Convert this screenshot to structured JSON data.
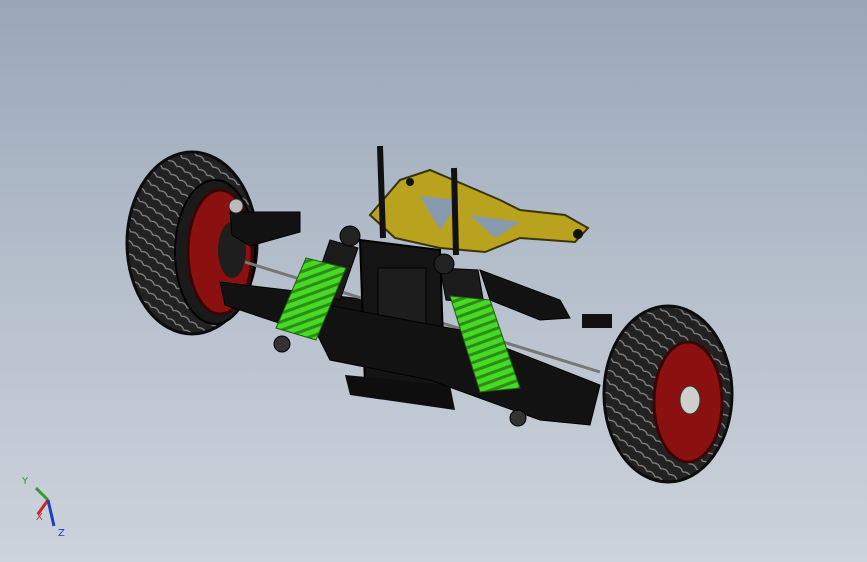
{
  "viewport": {
    "background_top": "#9aa6b8",
    "background_bottom": "#cdd3dc"
  },
  "model": {
    "tire_color": "#1c1c1c",
    "rim_color": "#8b1010",
    "spring_color": "#3fcf1f",
    "plate_color": "#b8a21e",
    "chassis_color": "#121212"
  },
  "triad": {
    "y_label": "Y",
    "x_label": "X",
    "z_label": "Z",
    "y_color": "#2a9d2a",
    "x_color": "#c62828",
    "z_color": "#1e3fbf"
  }
}
